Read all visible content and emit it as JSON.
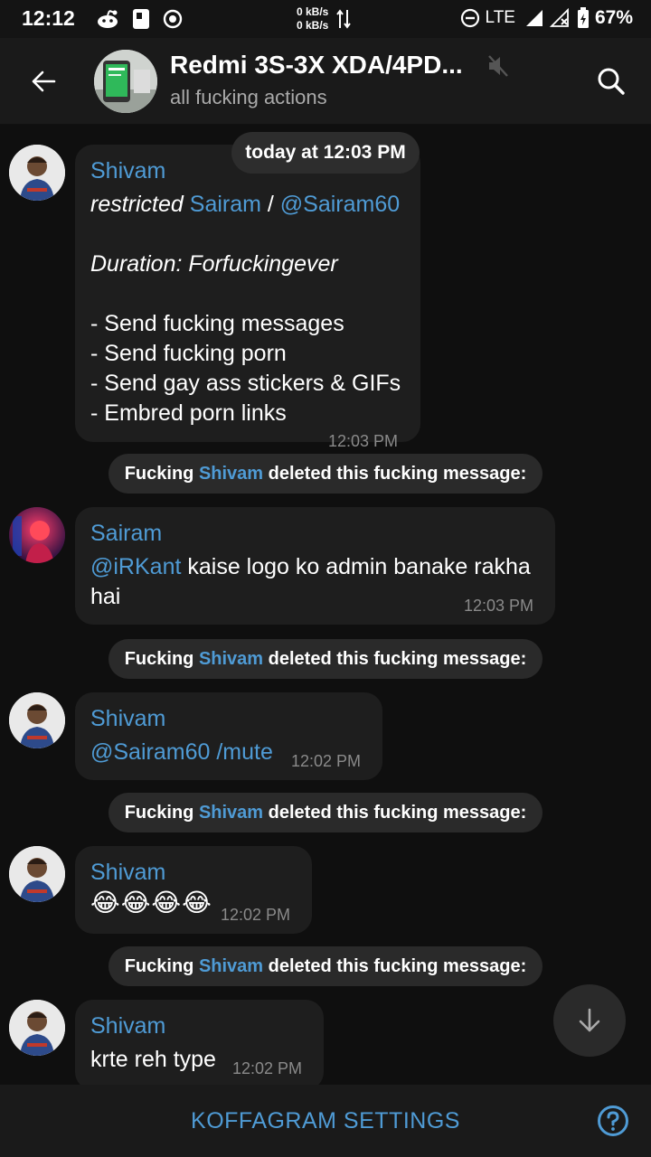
{
  "status_bar": {
    "time": "12:12",
    "net_up": "0 kB/s",
    "net_down": "0 kB/s",
    "network": "LTE",
    "battery": "67%"
  },
  "header": {
    "title": "Redmi 3S-3X XDA/4PD...",
    "subtitle": "all fucking actions"
  },
  "date_divider": "today at 12:03 PM",
  "messages": [
    {
      "sender": "Shivam",
      "action": "restricted",
      "target_name": "Sairam",
      "separator": " / ",
      "target_handle": "@Sairam60",
      "duration": "Duration: Forfuckingever",
      "lines": [
        "- Send fucking messages",
        "- Send fucking porn",
        "- Send gay ass stickers & GIFs",
        "- Embred porn links"
      ],
      "time": "12:03 PM"
    },
    {
      "sender": "Sairam",
      "mention": "@iRKant",
      "text_a": " kaise logo ko admin banake rakha",
      "text_b": "hai",
      "time": "12:03 PM"
    },
    {
      "sender": "Shivam",
      "command": "@Sairam60 /mute",
      "time": "12:02 PM"
    },
    {
      "sender": "Shivam",
      "emoji": "😂😂😂😂",
      "time": "12:02 PM"
    },
    {
      "sender": "Shivam",
      "text": "krte reh type",
      "time": "12:02 PM"
    }
  ],
  "system_message": {
    "prefix": "Fucking ",
    "user": "Shivam",
    "suffix": " deleted this fucking message:"
  },
  "bottom_bar": {
    "settings_label": "KOFFAGRAM SETTINGS"
  },
  "colors": {
    "accent": "#4f9bd5",
    "background": "#0f0f0f",
    "bubble": "#1e1e1e"
  }
}
